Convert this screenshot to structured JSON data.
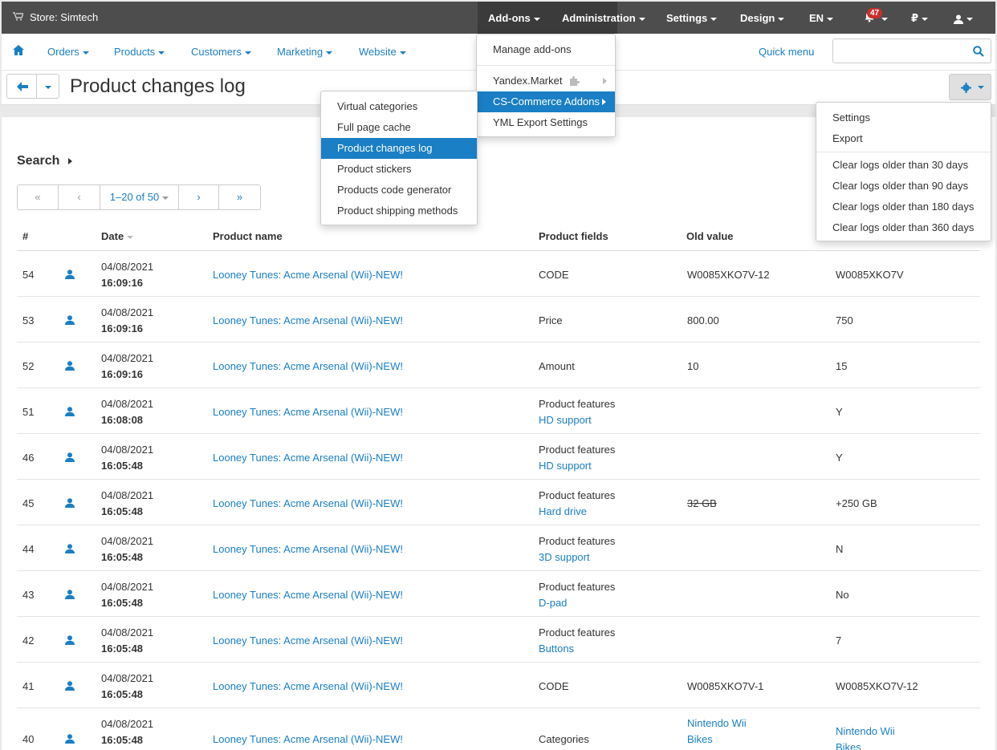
{
  "topbar": {
    "store_label": "Store: Simtech",
    "nav": [
      {
        "label": "Add-ons"
      },
      {
        "label": "Administration"
      },
      {
        "label": "Settings"
      },
      {
        "label": "Design"
      },
      {
        "label": "EN"
      }
    ],
    "notifications_count": "47",
    "currency": "₽"
  },
  "nav2": {
    "items": [
      "Orders",
      "Products",
      "Customers",
      "Marketing",
      "Website"
    ],
    "quick_menu": "Quick menu",
    "search_placeholder": ""
  },
  "page": {
    "title": "Product changes log",
    "search_label": "Search"
  },
  "pager": {
    "first": "«",
    "prev": "‹",
    "range": "1–20 of 50",
    "next": "›",
    "last": "»"
  },
  "table": {
    "headers": [
      "#",
      "Date",
      "Product name",
      "Product fields",
      "Old value"
    ],
    "rows": [
      {
        "id": "54",
        "date": "04/08/2021",
        "time": "16:09:16",
        "product": "Looney Tunes: Acme Arsenal (Wii)-NEW!",
        "field": "CODE",
        "field_sub": "",
        "old": "W0085XKO7V-12",
        "old2": "",
        "new": "W0085XKO7V",
        "new2": ""
      },
      {
        "id": "53",
        "date": "04/08/2021",
        "time": "16:09:16",
        "product": "Looney Tunes: Acme Arsenal (Wii)-NEW!",
        "field": "Price",
        "field_sub": "",
        "old": "800.00",
        "old2": "",
        "new": "750",
        "new2": ""
      },
      {
        "id": "52",
        "date": "04/08/2021",
        "time": "16:09:16",
        "product": "Looney Tunes: Acme Arsenal (Wii)-NEW!",
        "field": "Amount",
        "field_sub": "",
        "old": "10",
        "old2": "",
        "new": "15",
        "new2": ""
      },
      {
        "id": "51",
        "date": "04/08/2021",
        "time": "16:08:08",
        "product": "Looney Tunes: Acme Arsenal (Wii)-NEW!",
        "field": "Product features",
        "field_sub": "HD support",
        "old": "",
        "old2": "",
        "new": "Y",
        "new2": ""
      },
      {
        "id": "46",
        "date": "04/08/2021",
        "time": "16:05:48",
        "product": "Looney Tunes: Acme Arsenal (Wii)-NEW!",
        "field": "Product features",
        "field_sub": "HD support",
        "old": "",
        "old2": "",
        "new": "Y",
        "new2": ""
      },
      {
        "id": "45",
        "date": "04/08/2021",
        "time": "16:05:48",
        "product": "Looney Tunes: Acme Arsenal (Wii)-NEW!",
        "field": "Product features",
        "field_sub": "Hard drive",
        "old": "32 GB",
        "old2": "",
        "new": "+250 GB",
        "new2": ""
      },
      {
        "id": "44",
        "date": "04/08/2021",
        "time": "16:05:48",
        "product": "Looney Tunes: Acme Arsenal (Wii)-NEW!",
        "field": "Product features",
        "field_sub": "3D support",
        "old": "",
        "old2": "",
        "new": "N",
        "new2": ""
      },
      {
        "id": "43",
        "date": "04/08/2021",
        "time": "16:05:48",
        "product": "Looney Tunes: Acme Arsenal (Wii)-NEW!",
        "field": "Product features",
        "field_sub": "D-pad",
        "old": "",
        "old2": "",
        "new": "No",
        "new2": ""
      },
      {
        "id": "42",
        "date": "04/08/2021",
        "time": "16:05:48",
        "product": "Looney Tunes: Acme Arsenal (Wii)-NEW!",
        "field": "Product features",
        "field_sub": "Buttons",
        "old": "",
        "old2": "",
        "new": "7",
        "new2": ""
      },
      {
        "id": "41",
        "date": "04/08/2021",
        "time": "16:05:48",
        "product": "Looney Tunes: Acme Arsenal (Wii)-NEW!",
        "field": "CODE",
        "field_sub": "",
        "old": "W0085XKO7V-1",
        "old2": "",
        "new": "W0085XKO7V-12",
        "new2": ""
      },
      {
        "id": "40",
        "date": "04/08/2021",
        "time": "16:05:48",
        "product": "Looney Tunes: Acme Arsenal (Wii)-NEW!",
        "field": "Categories",
        "field_sub": "",
        "old": "Nintendo Wii",
        "old2": "Bikes",
        "new": "Nintendo Wii",
        "new2": "Bikes"
      }
    ]
  },
  "addons_menu": {
    "items": [
      "Manage add-ons",
      "Yandex.Market",
      "CS-Commerce Addons",
      "YML Export Settings"
    ]
  },
  "cscommerce_submenu": {
    "items": [
      "Virtual categories",
      "Full page cache",
      "Product changes log",
      "Product stickers",
      "Products code generator",
      "Product shipping methods"
    ]
  },
  "gear_menu": {
    "items": [
      "Settings",
      "Export",
      "Clear logs older than 30 days",
      "Clear logs older than 90 days",
      "Clear logs older than 180 days",
      "Clear logs older than 360 days"
    ]
  },
  "colors": {
    "topbar": "#4d4d4d",
    "link": "#1a7fc4",
    "active_item": "#1a7fc4",
    "badge": "#c9302c"
  }
}
